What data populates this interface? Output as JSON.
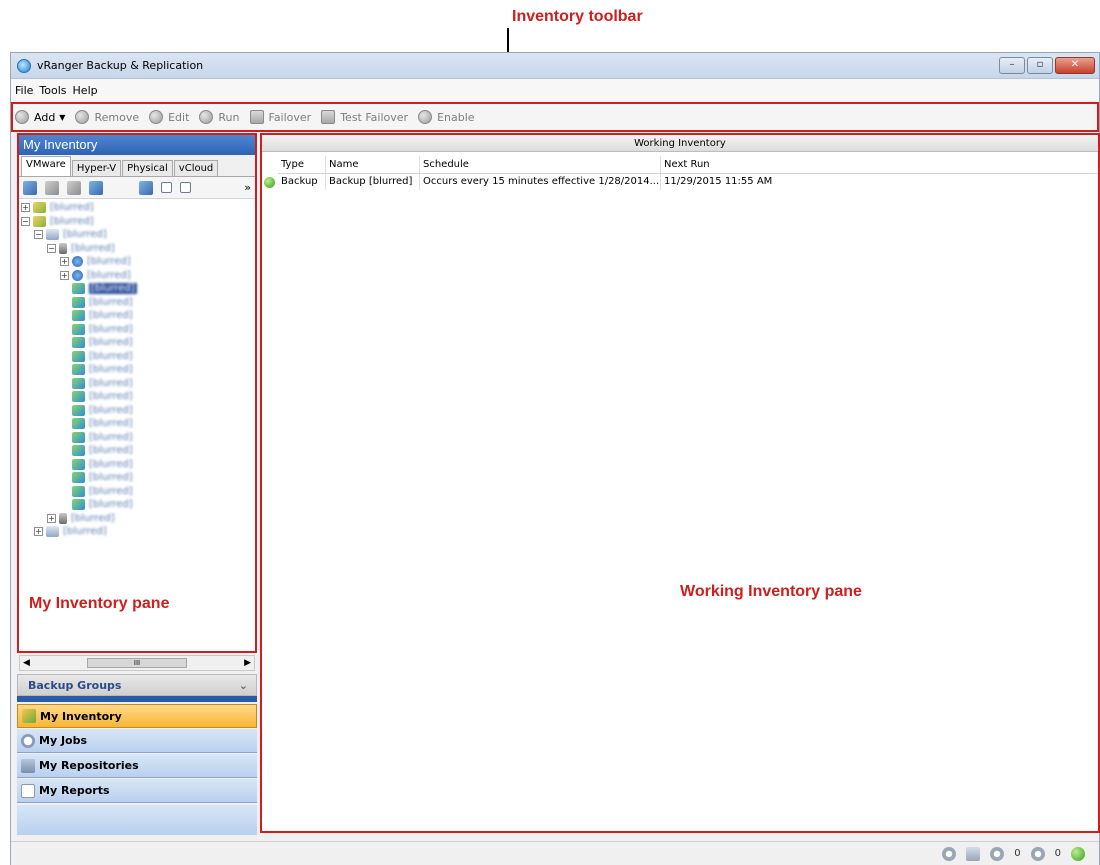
{
  "annotations": {
    "toolbar": "Inventory toolbar",
    "left": "My Inventory pane",
    "right": "Working Inventory pane"
  },
  "window": {
    "title": "vRanger Backup & Replication"
  },
  "menu": [
    "File",
    "Tools",
    "Help"
  ],
  "toolbar": {
    "add": "Add",
    "remove": "Remove",
    "edit": "Edit",
    "run": "Run",
    "failover": "Failover",
    "test_failover": "Test Failover",
    "enable": "Enable"
  },
  "left_pane": {
    "title": "My Inventory",
    "tabs": [
      "VMware",
      "Hyper-V",
      "Physical",
      "vCloud"
    ],
    "tree": [
      {
        "label": "[blurred]",
        "level": 0,
        "icon": "datacenter-icon",
        "expander": "+"
      },
      {
        "label": "[blurred]",
        "level": 0,
        "icon": "datacenter-icon",
        "expander": "-"
      },
      {
        "label": "[blurred]",
        "level": 1,
        "icon": "host-icon",
        "expander": "-"
      },
      {
        "label": "[blurred]",
        "level": 2,
        "icon": "server-icon",
        "expander": "-"
      },
      {
        "label": "[blurred]",
        "level": 3,
        "icon": "pool-icon",
        "expander": "+"
      },
      {
        "label": "[blurred]",
        "level": 3,
        "icon": "pool-icon",
        "expander": "+"
      },
      {
        "label": "[blurred]",
        "level": 3,
        "icon": "vm-icon",
        "expander": "",
        "selected": true
      },
      {
        "label": "[blurred]",
        "level": 3,
        "icon": "vm-icon",
        "expander": ""
      },
      {
        "label": "[blurred]",
        "level": 3,
        "icon": "vm-icon",
        "expander": ""
      },
      {
        "label": "[blurred]",
        "level": 3,
        "icon": "vm-icon",
        "expander": ""
      },
      {
        "label": "[blurred]",
        "level": 3,
        "icon": "vm-icon",
        "expander": ""
      },
      {
        "label": "[blurred]",
        "level": 3,
        "icon": "vm-icon",
        "expander": ""
      },
      {
        "label": "[blurred]",
        "level": 3,
        "icon": "vm-icon",
        "expander": ""
      },
      {
        "label": "[blurred]",
        "level": 3,
        "icon": "vm-icon",
        "expander": ""
      },
      {
        "label": "[blurred]",
        "level": 3,
        "icon": "vm-icon",
        "expander": ""
      },
      {
        "label": "[blurred]",
        "level": 3,
        "icon": "vm-icon",
        "expander": ""
      },
      {
        "label": "[blurred]",
        "level": 3,
        "icon": "vm-icon",
        "expander": ""
      },
      {
        "label": "[blurred]",
        "level": 3,
        "icon": "vm-icon",
        "expander": ""
      },
      {
        "label": "[blurred]",
        "level": 3,
        "icon": "vm-icon",
        "expander": ""
      },
      {
        "label": "[blurred]",
        "level": 3,
        "icon": "vm-icon",
        "expander": ""
      },
      {
        "label": "[blurred]",
        "level": 3,
        "icon": "vm-icon",
        "expander": ""
      },
      {
        "label": "[blurred]",
        "level": 3,
        "icon": "vm-icon",
        "expander": ""
      },
      {
        "label": "[blurred]",
        "level": 3,
        "icon": "vm-icon",
        "expander": ""
      },
      {
        "label": "[blurred]",
        "level": 2,
        "icon": "server-icon",
        "expander": "+"
      },
      {
        "label": "[blurred]",
        "level": 1,
        "icon": "host-icon",
        "expander": "+"
      }
    ],
    "scrollbar_label": "III",
    "backup_groups": "Backup Groups"
  },
  "nav": {
    "inventory": "My Inventory",
    "jobs": "My Jobs",
    "repositories": "My Repositories",
    "reports": "My Reports"
  },
  "right_pane": {
    "title": "Working Inventory",
    "columns": [
      "Type",
      "Name",
      "Schedule",
      "Next Run"
    ],
    "rows": [
      {
        "type": "Backup",
        "name": "Backup [blurred]",
        "schedule": "Occurs every 15 minutes  effective 1/28/2014...",
        "next_run": "11/29/2015 11:55 AM"
      }
    ]
  },
  "statusbar": {
    "jobs_count": "0",
    "tasks_count": "0"
  }
}
